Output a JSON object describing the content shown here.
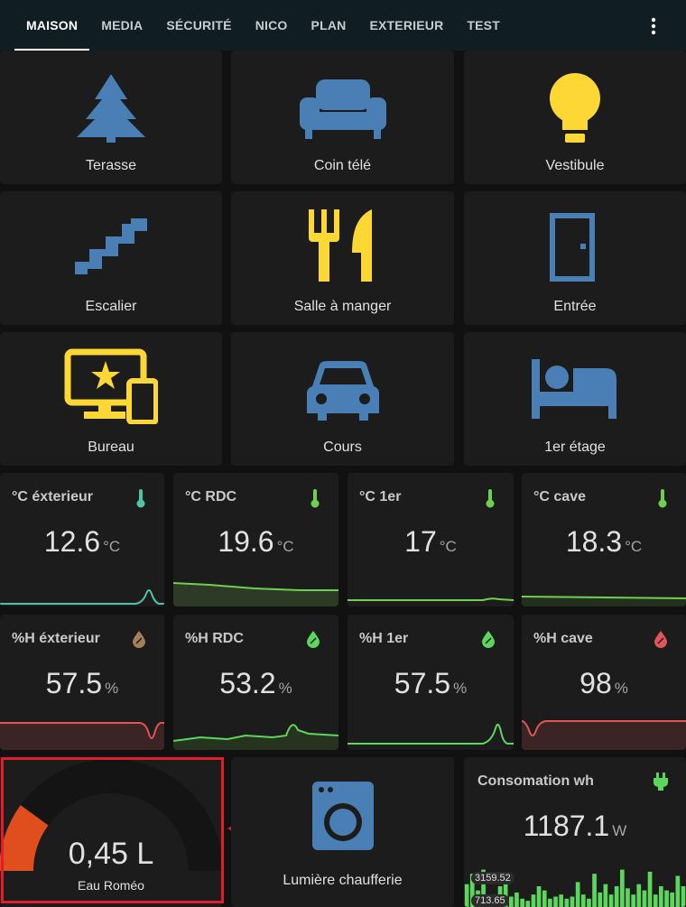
{
  "tabs": [
    {
      "label": "MAISON",
      "active": true
    },
    {
      "label": "MEDIA"
    },
    {
      "label": "SÉCURITÉ"
    },
    {
      "label": "NICO"
    },
    {
      "label": "PLAN"
    },
    {
      "label": "EXTERIEUR"
    },
    {
      "label": "TEST"
    }
  ],
  "menu_icon": "dots-vertical-icon",
  "buttons": [
    {
      "label": "Terasse",
      "icon": "pine-tree-icon",
      "color": "#4a7fb5"
    },
    {
      "label": "Coin télé",
      "icon": "sofa-icon",
      "color": "#4a7fb5"
    },
    {
      "label": "Vestibule",
      "icon": "lightbulb-icon",
      "color": "#fdd835"
    },
    {
      "label": "Escalier",
      "icon": "stairs-icon",
      "color": "#4a7fb5"
    },
    {
      "label": "Salle à manger",
      "icon": "silverware-icon",
      "color": "#fdd835"
    },
    {
      "label": "Entrée",
      "icon": "door-icon",
      "color": "#4a7fb5"
    },
    {
      "label": "Bureau",
      "icon": "monitor-star-icon",
      "color": "#fdd835"
    },
    {
      "label": "Cours",
      "icon": "car-icon",
      "color": "#4a7fb5"
    },
    {
      "label": "1er étage",
      "icon": "bed-icon",
      "color": "#4a7fb5"
    },
    {
      "label": "Lumière chaufferie",
      "icon": "washing-machine-icon",
      "color": "#4a7fb5"
    }
  ],
  "temperature": [
    {
      "name": "°C éxterieur",
      "value": "12.6",
      "unit": "°C",
      "icon": "thermometer-icon",
      "color": "#4ec3a8"
    },
    {
      "name": "°C RDC",
      "value": "19.6",
      "unit": "°C",
      "icon": "thermometer-icon",
      "color": "#6fcf4f"
    },
    {
      "name": "°C 1er",
      "value": "17",
      "unit": "°C",
      "icon": "thermometer-icon",
      "color": "#6fcf4f"
    },
    {
      "name": "°C cave",
      "value": "18.3",
      "unit": "°C",
      "icon": "thermometer-icon",
      "color": "#6fcf4f"
    }
  ],
  "humidity": [
    {
      "name": "%H éxterieur",
      "value": "57.5",
      "unit": "%",
      "icon": "water-percent-icon",
      "color": "#a57f57"
    },
    {
      "name": "%H RDC",
      "value": "53.2",
      "unit": "%",
      "icon": "water-percent-icon",
      "color": "#5cd65c"
    },
    {
      "name": "%H 1er",
      "value": "57.5",
      "unit": "%",
      "icon": "water-percent-icon",
      "color": "#5cd65c"
    },
    {
      "name": "%H cave",
      "value": "98",
      "unit": "%",
      "icon": "water-percent-icon",
      "color": "#e05555"
    }
  ],
  "gauge": {
    "value": "0,45 L",
    "name": "Eau Roméo",
    "fraction": 0.2,
    "color": "#e04e1e"
  },
  "power": {
    "name": "Consomation wh",
    "value": "1187.1",
    "unit": "W",
    "icon": "power-plug-icon",
    "color": "#5cd65c",
    "max_label": "3159.52",
    "min_label": "713.65",
    "bars": [
      0.55,
      0.8,
      0.4,
      0.9,
      0.3,
      0.2,
      0.5,
      0.6,
      0.25,
      0.35,
      0.2,
      0.15,
      0.3,
      0.5,
      0.4,
      0.2,
      0.25,
      0.3,
      0.2,
      0.25,
      0.6,
      0.3,
      0.2,
      0.8,
      0.35,
      0.55,
      0.3,
      0.5,
      0.9,
      0.45,
      0.3,
      0.55,
      0.4,
      0.85,
      0.3,
      0.5,
      0.4,
      0.35,
      0.75,
      0.5
    ]
  }
}
